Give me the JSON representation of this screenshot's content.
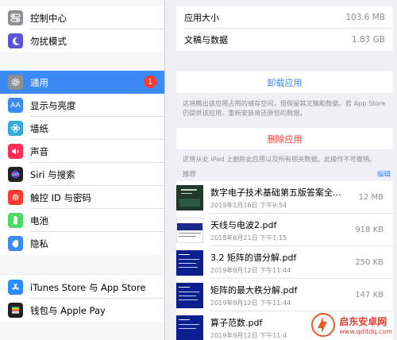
{
  "sidebar": {
    "group1": [
      {
        "label": "控制中心",
        "icon": "switches-icon",
        "color": "#8e8e93"
      },
      {
        "label": "勿扰模式",
        "icon": "moon-icon",
        "color": "#5856d6"
      }
    ],
    "group2": [
      {
        "label": "通用",
        "icon": "gear-icon",
        "color": "#8e8e93",
        "badge": "1"
      },
      {
        "label": "显示与亮度",
        "icon": "text-size-icon",
        "color": "#3c8af5"
      },
      {
        "label": "墙纸",
        "icon": "flower-icon",
        "color": "#35aadc"
      },
      {
        "label": "声音",
        "icon": "speaker-icon",
        "color": "#ff2d55"
      },
      {
        "label": "Siri 与搜索",
        "icon": "siri-icon",
        "color": "#222222"
      },
      {
        "label": "触控 ID 与密码",
        "icon": "fingerprint-icon",
        "color": "#ff3b30"
      },
      {
        "label": "电池",
        "icon": "battery-icon",
        "color": "#4cd964"
      },
      {
        "label": "隐私",
        "icon": "hand-icon",
        "color": "#3c8af5"
      }
    ],
    "group3": [
      {
        "label": "iTunes Store 与 App Store",
        "icon": "app-store-icon",
        "color": "#2b8cf4"
      },
      {
        "label": "钱包与 Apple Pay",
        "icon": "wallet-icon",
        "color": "#222222"
      }
    ]
  },
  "main": {
    "app_size_label": "应用大小",
    "app_size_value": "103.6 MB",
    "docs_label": "文稿与数据",
    "docs_value": "1.83 GB",
    "offload_button": "卸载应用",
    "offload_note": "这将腾出该应用占用的储存空间，但保留其文稿和数据。若 App Store 仍提供该应用，重新安装将还原您的数据。",
    "delete_button": "删除应用",
    "delete_note": "这将从此 iPad 上删除此应用以及所有相关数据。此操作不可撤销。",
    "section_header": "推荐",
    "edit_label": "编辑",
    "files": [
      {
        "name": "数字电子技术基础第五版答案全...",
        "date": "2019年1月16日 下午9:54",
        "size": "12 MB",
        "thumb": "book-cover"
      },
      {
        "name": "天线与电波2.pdf",
        "date": "2018年6月21日 下午1:15",
        "size": "918 KB",
        "thumb": "pdf-page"
      },
      {
        "name": "3.2 矩阵的谱分解.pdf",
        "date": "2019年9月12日 下午11:44",
        "size": "250 KB",
        "thumb": "pdf-page"
      },
      {
        "name": "矩阵的最大秩分解.pdf",
        "date": "2019年9月12日 下午11:44",
        "size": "147 KB",
        "thumb": "pdf-page"
      },
      {
        "name": "算子范数.pdf",
        "date": "2019年9月12日 下午11:4",
        "size": "",
        "thumb": "pdf-page"
      }
    ]
  },
  "watermark": {
    "title": "启东安卓网",
    "url": "www.qdltdq.com"
  },
  "colors": {
    "accent": "#3c8af5",
    "delete": "#ff3b30"
  }
}
